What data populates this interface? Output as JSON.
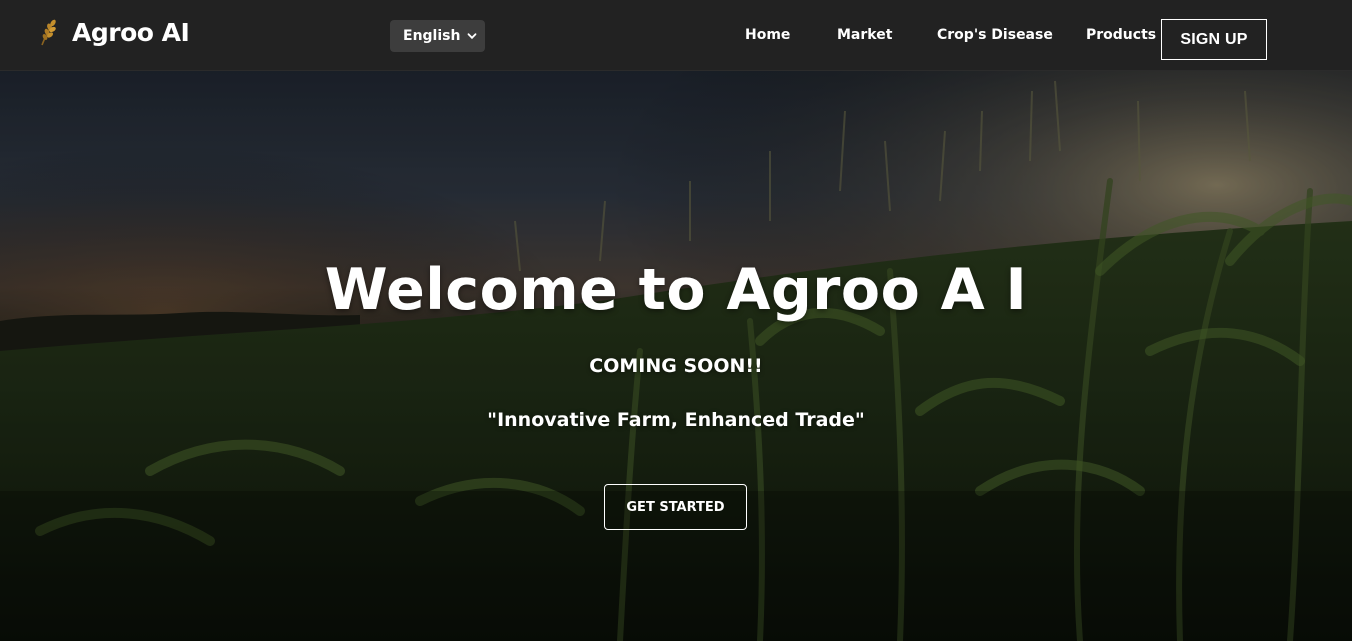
{
  "navbar": {
    "brand": {
      "name": "Agroo AI",
      "icon": "wheat-icon"
    },
    "language": {
      "selected": "English",
      "icon": "chevron-down-icon"
    },
    "links": [
      {
        "label": "Home"
      },
      {
        "label": "Market"
      },
      {
        "label": "Crop's Disease"
      },
      {
        "label": "Products"
      }
    ],
    "signup_label": "SIGN UP"
  },
  "hero": {
    "title": "Welcome to Agroo A I",
    "subtitle": "COMING SOON!!",
    "tagline": "\"Innovative Farm, Enhanced Trade\"",
    "cta_label": "GET STARTED",
    "background": "corn-field-sunset-photo"
  },
  "colors": {
    "navbar_bg": "#222222",
    "select_bg": "#3d3d3d",
    "text": "#ffffff",
    "brand_icon": "#b9862a"
  }
}
